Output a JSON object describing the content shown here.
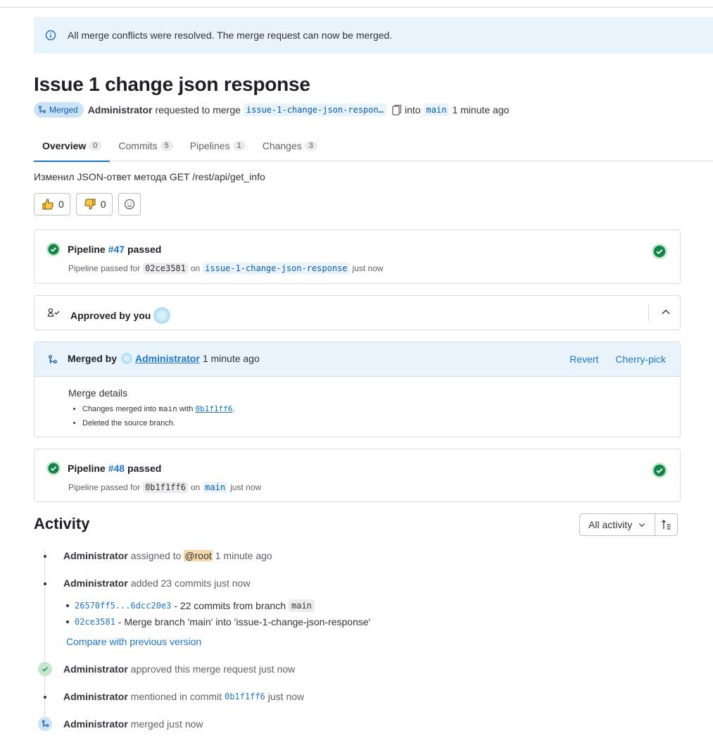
{
  "alert": {
    "text": "All merge conflicts were resolved. The merge request can now be merged."
  },
  "mr": {
    "title": "Issue 1 change json response",
    "status": "Merged",
    "author": "Administrator",
    "requested_text": "requested to merge",
    "source_branch": "issue-1-change-json-respon…",
    "into_text": "into",
    "target_branch": "main",
    "time": "1 minute ago"
  },
  "tabs": [
    {
      "label": "Overview",
      "count": "0"
    },
    {
      "label": "Commits",
      "count": "5"
    },
    {
      "label": "Pipelines",
      "count": "1"
    },
    {
      "label": "Changes",
      "count": "3"
    }
  ],
  "description": "Изменил JSON-ответ метода GET /rest/api/get_info",
  "reactions": {
    "thumbs_up": "0",
    "thumbs_down": "0"
  },
  "pipeline1": {
    "prefix": "Pipeline",
    "id": "#47",
    "status": "passed",
    "sub_prefix": "Pipeline passed for",
    "commit": "02ce3581",
    "on": "on",
    "branch": "issue-1-change-json-response",
    "when": "just now"
  },
  "approval": {
    "label": "Approved by you"
  },
  "merged": {
    "label": "Merged by",
    "user": "Administrator",
    "time": "1 minute ago",
    "revert": "Revert",
    "cherry_pick": "Cherry-pick",
    "details_title": "Merge details",
    "detail1_prefix": "Changes merged into",
    "detail1_branch": "main",
    "detail1_with": "with",
    "detail1_sha": "0b1f1ff6",
    "detail1_suffix": ".",
    "detail2": "Deleted the source branch."
  },
  "pipeline2": {
    "prefix": "Pipeline",
    "id": "#48",
    "status": "passed",
    "sub_prefix": "Pipeline passed for",
    "commit": "0b1f1ff6",
    "on": "on",
    "branch": "main",
    "when": "just now"
  },
  "activity": {
    "title": "Activity",
    "filter": "All activity",
    "items": [
      {
        "user": "Administrator",
        "text": "assigned to",
        "mention": "@root",
        "time": "1 minute ago"
      },
      {
        "user": "Administrator",
        "text": "added 23 commits just now"
      },
      {
        "user": "Administrator",
        "text": "approved this merge request just now"
      },
      {
        "user": "Administrator",
        "text": "mentioned in commit",
        "sha": "0b1f1ff6",
        "time": "just now"
      },
      {
        "user": "Administrator",
        "text": "merged just now"
      }
    ],
    "commits": [
      {
        "sha": "26570ff5...6dcc20e3",
        "text": "- 22 commits from branch",
        "branch": "main"
      },
      {
        "sha": "02ce3581",
        "text": "- Merge branch 'main' into 'issue-1-change-json-response'"
      }
    ],
    "compare": "Compare with previous version"
  },
  "colors": {
    "accent": "#1f75cb",
    "success": "#108548",
    "alert_bg": "#e9f3fc"
  }
}
